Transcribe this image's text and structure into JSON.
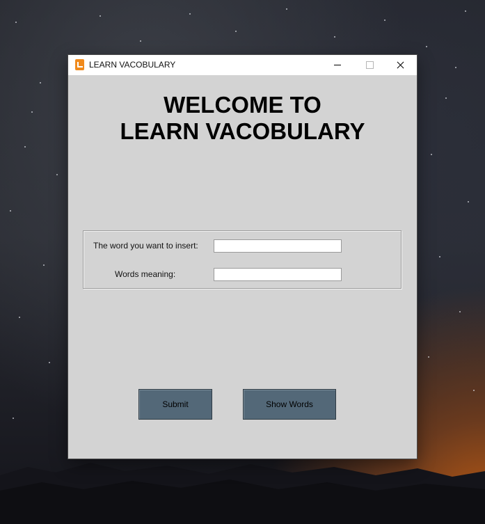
{
  "window": {
    "title": "LEARN VACOBULARY",
    "icon": "app-icon",
    "controls": [
      "minimize-icon",
      "maximize-icon",
      "close-icon"
    ]
  },
  "heading": {
    "line1": "WELCOME TO",
    "line2": "LEARN VACOBULARY"
  },
  "form": {
    "word_label": "The word you want to insert:",
    "word_value": "",
    "meaning_label": "Words meaning:",
    "meaning_value": ""
  },
  "buttons": {
    "submit_label": "Submit",
    "show_words_label": "Show Words"
  },
  "colors": {
    "window_bg": "#d3d3d3",
    "button_bg": "#536878",
    "icon_accent": "#f08a1c"
  }
}
